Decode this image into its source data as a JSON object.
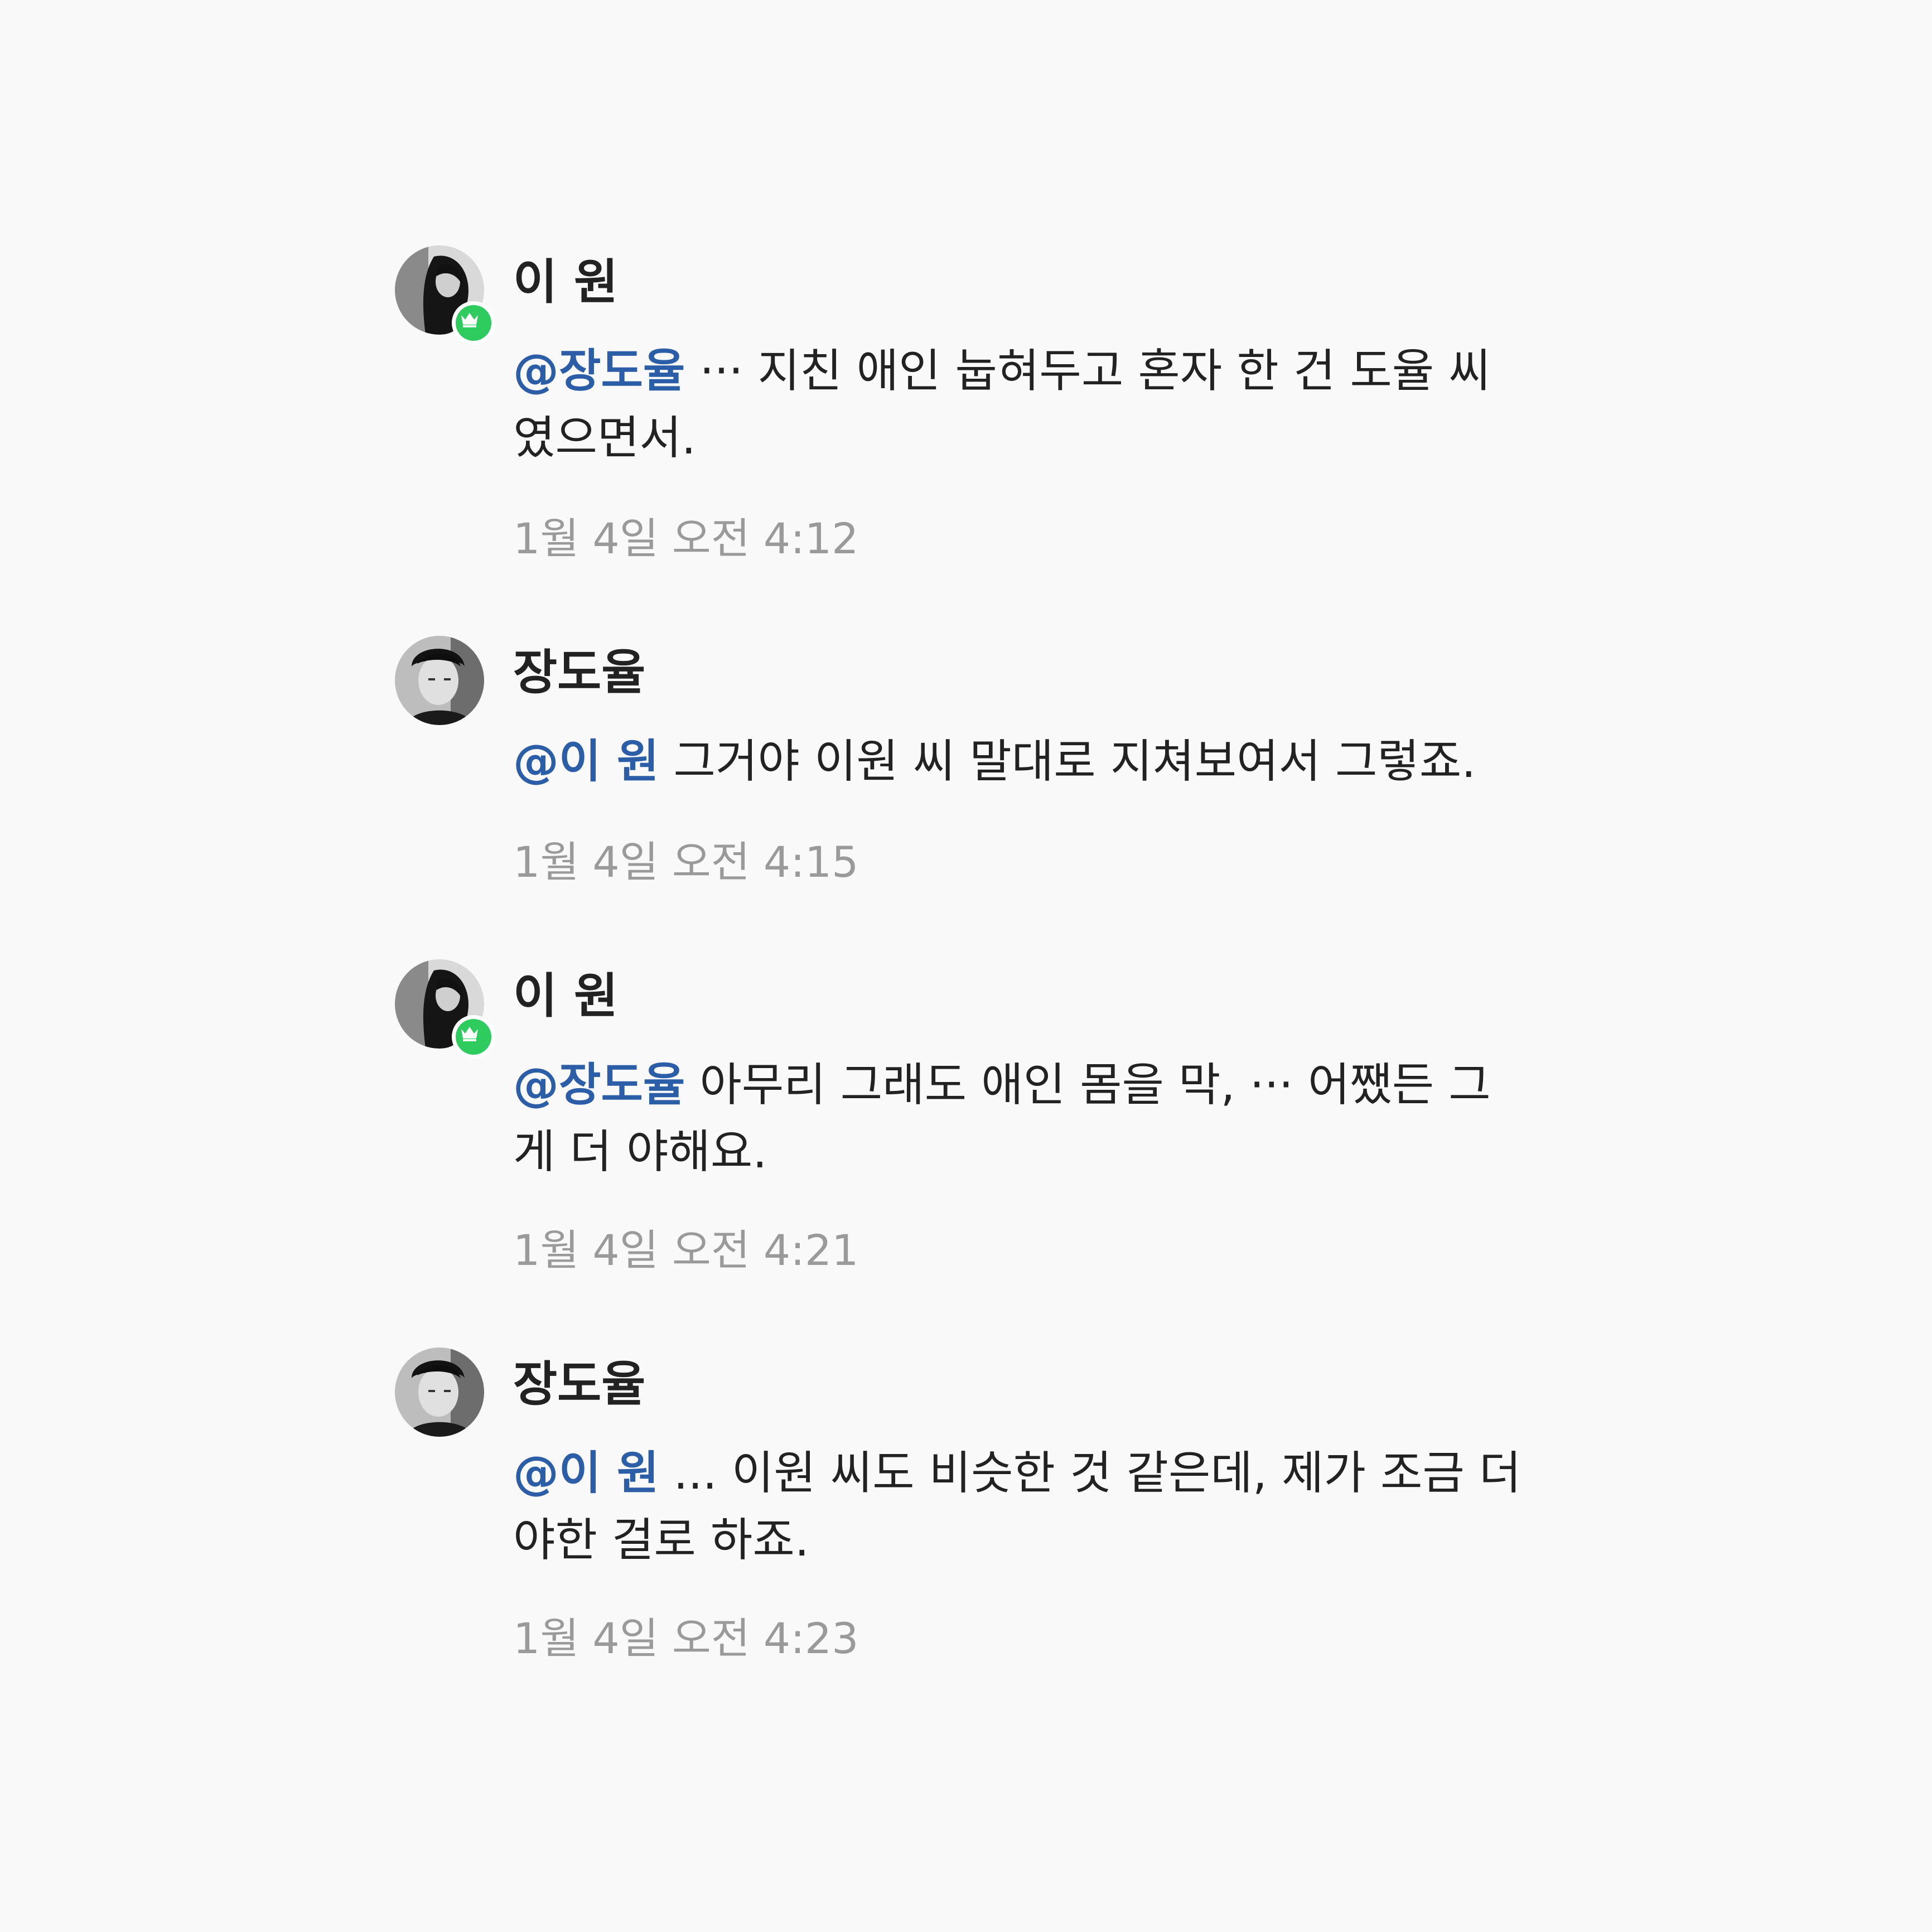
{
  "comments": [
    {
      "author": "이 원",
      "mention": "@장도율",
      "text": " ··· 지친 애인 눕혀두고 혼자 한 건 도율 씨 였으면서.",
      "time": "1월 4일 오전 4:12",
      "avatar_icon": "avatar-woman-photo-icon",
      "badge_icon": "crown-icon",
      "badge_color": "#2ecc5e"
    },
    {
      "author": "장도율",
      "mention": "@이 원",
      "text": " 그거야 이원 씨 말대로 지쳐보여서 그렇죠.",
      "time": "1월 4일 오전 4:15",
      "avatar_icon": "avatar-man-photo-icon"
    },
    {
      "author": "이 원",
      "mention": "@장도율",
      "text": " 아무리 그래도 애인 몸을 막, ··· 어쨌든 그게 더 야해요.",
      "time": "1월 4일 오전 4:21",
      "avatar_icon": "avatar-woman-photo-icon",
      "badge_icon": "crown-icon",
      "badge_color": "#2ecc5e"
    },
    {
      "author": "장도율",
      "mention": "@이 원",
      "text": " ... 이원 씨도 비슷한 것 같은데, 제가 조금 더 야한 걸로 하죠.",
      "time": "1월 4일 오전 4:23",
      "avatar_icon": "avatar-man-photo-icon"
    }
  ],
  "colors": {
    "background": "#f9f9fa",
    "mention": "#2c5ea8",
    "text": "#222222",
    "timestamp": "#9a9a9a"
  }
}
